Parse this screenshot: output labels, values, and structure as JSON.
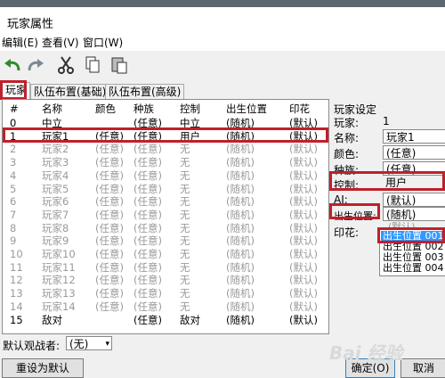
{
  "window": {
    "title": "玩家属性"
  },
  "menu": {
    "items": [
      "编辑(E)",
      "查看(V)",
      "窗口(W)"
    ]
  },
  "toolbar": {
    "icons": [
      "undo-icon",
      "redo-icon",
      "cut-icon",
      "copy-icon",
      "paste-icon"
    ]
  },
  "tabs": [
    "玩家",
    "队伍布置(基础)",
    "队伍布置(高级)"
  ],
  "table": {
    "headers": [
      "#",
      "名称",
      "颜色",
      "种族",
      "控制",
      "出生位置",
      "印花"
    ],
    "rows": [
      [
        "0",
        "中立",
        "",
        "(任意)",
        "中立",
        "(随机)",
        "(默认)"
      ],
      [
        "1",
        "玩家1",
        "(任意)",
        "(任意)",
        "用户",
        "(随机)",
        "(默认)"
      ],
      [
        "2",
        "玩家2",
        "(任意)",
        "(任意)",
        "无",
        "(随机)",
        "(默认)"
      ],
      [
        "3",
        "玩家3",
        "(任意)",
        "(任意)",
        "无",
        "(随机)",
        "(默认)"
      ],
      [
        "4",
        "玩家4",
        "(任意)",
        "(任意)",
        "无",
        "(随机)",
        "(默认)"
      ],
      [
        "5",
        "玩家5",
        "(任意)",
        "(任意)",
        "无",
        "(随机)",
        "(默认)"
      ],
      [
        "6",
        "玩家6",
        "(任意)",
        "(任意)",
        "无",
        "(随机)",
        "(默认)"
      ],
      [
        "7",
        "玩家7",
        "(任意)",
        "(任意)",
        "无",
        "(随机)",
        "(默认)"
      ],
      [
        "8",
        "玩家8",
        "(任意)",
        "(任意)",
        "无",
        "(随机)",
        "(默认)"
      ],
      [
        "9",
        "玩家9",
        "(任意)",
        "(任意)",
        "无",
        "(随机)",
        "(默认)"
      ],
      [
        "10",
        "玩家10",
        "(任意)",
        "(任意)",
        "无",
        "(随机)",
        "(默认)"
      ],
      [
        "11",
        "玩家11",
        "(任意)",
        "(任意)",
        "无",
        "(随机)",
        "(默认)"
      ],
      [
        "12",
        "玩家12",
        "(任意)",
        "(任意)",
        "无",
        "(随机)",
        "(默认)"
      ],
      [
        "13",
        "玩家13",
        "(任意)",
        "(任意)",
        "无",
        "(随机)",
        "(默认)"
      ],
      [
        "14",
        "玩家14",
        "(任意)",
        "(任意)",
        "无",
        "(随机)",
        "(默认)"
      ],
      [
        "15",
        "敌对",
        "",
        "(任意)",
        "敌对",
        "(随机)",
        "(默认)"
      ]
    ]
  },
  "settings": {
    "heading": "玩家设定",
    "player_label": "玩家:",
    "player_value": "1",
    "name_label": "名称:",
    "name_value": "玩家1",
    "color_label": "颜色:",
    "color_value": "(任意)",
    "race_label": "种族:",
    "race_value": "(任意)",
    "control_label": "控制:",
    "control_value": "用户",
    "ai_label": "AI:",
    "ai_value": "(默认)",
    "spawn_label": "出生位置:",
    "spawn_value": "(随机)",
    "decal_label": "印花:",
    "spawn_options": [
      "出生位置 001",
      "出生位置 002",
      "出生位置 003",
      "出生位置 004"
    ],
    "ghost_values": [
      "(随机)",
      "(默认)"
    ]
  },
  "bottom": {
    "observer_label": "默认观战者:",
    "observer_value": "(无)",
    "reset_button": "重设为默认",
    "ok_button": "确定(O)",
    "cancel_button": "取消"
  },
  "watermark": "Bai 经验",
  "colors": {
    "highlight": "#c0202a",
    "selection": "#3399ff"
  }
}
